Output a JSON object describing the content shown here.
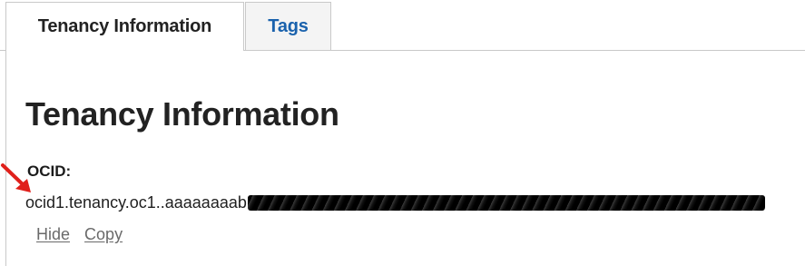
{
  "tabs": [
    {
      "label": "Tenancy Information",
      "active": true
    },
    {
      "label": "Tags",
      "active": false
    }
  ],
  "panel": {
    "title": "Tenancy Information",
    "ocid_label": "OCID:",
    "ocid_value_visible": "ocid1.tenancy.oc1..aaaaaaaab",
    "actions": {
      "hide": "Hide",
      "copy": "Copy"
    }
  },
  "annotation": {
    "icon": "red-arrow-icon",
    "color": "#e0201b"
  },
  "colors": {
    "tab_link": "#1a62ad",
    "text": "#222222",
    "muted_link": "#6a6a6a",
    "border": "#c9c9c9"
  }
}
